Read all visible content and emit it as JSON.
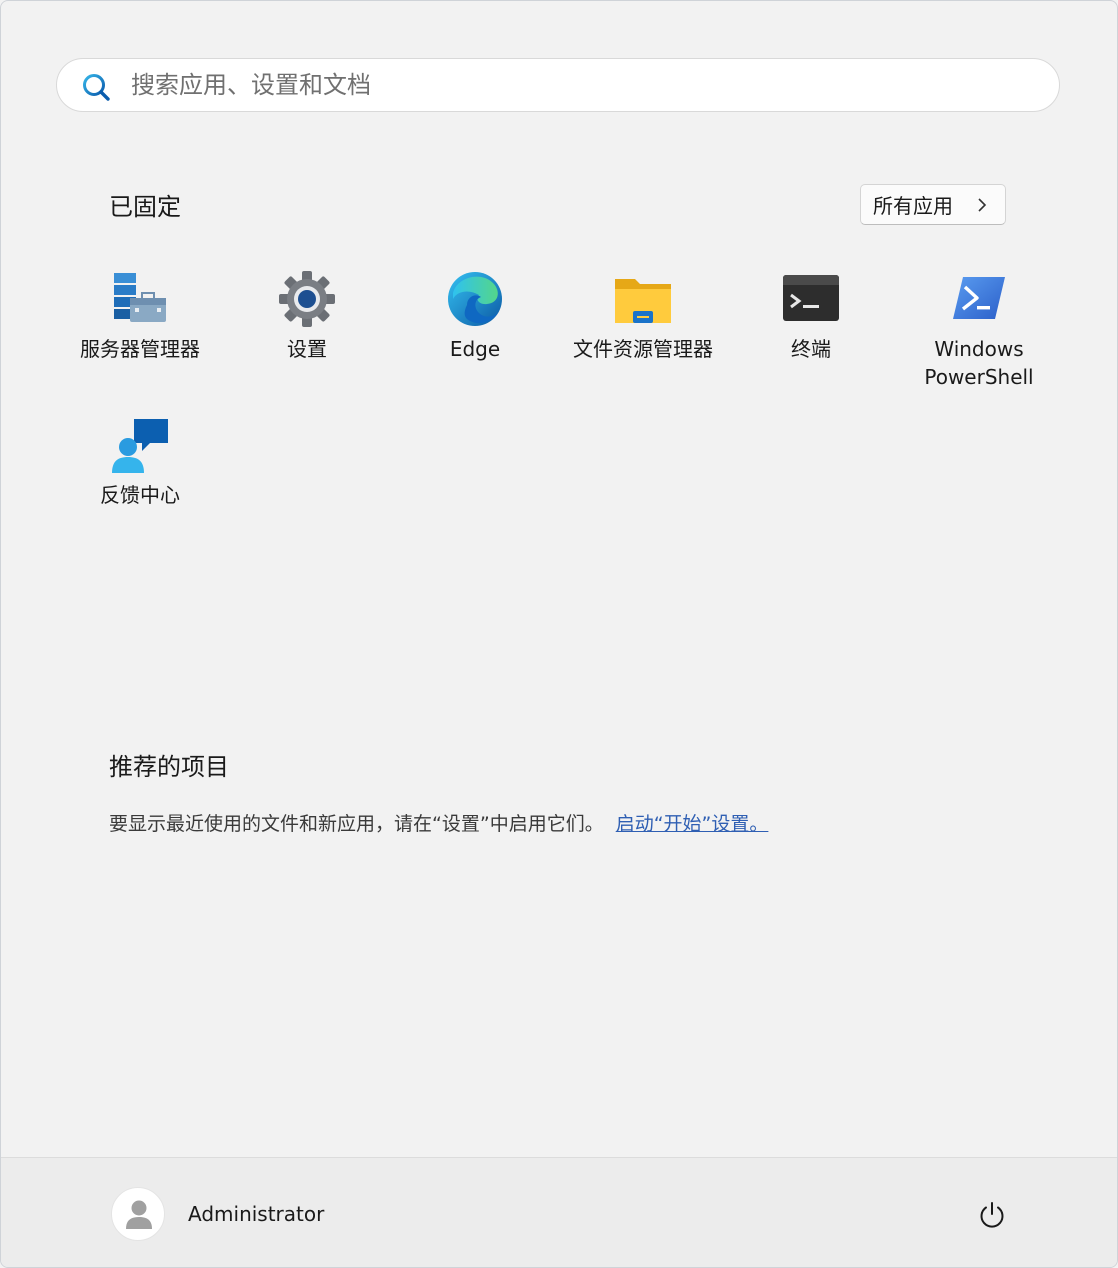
{
  "search": {
    "placeholder": "搜索应用、设置和文档"
  },
  "pinned": {
    "title": "已固定",
    "all_apps_label": "所有应用",
    "apps": [
      {
        "label": "服务器管理器",
        "icon": "server-manager-icon"
      },
      {
        "label": "设置",
        "icon": "settings-gear-icon"
      },
      {
        "label": "Edge",
        "icon": "edge-icon"
      },
      {
        "label": "文件资源管理器",
        "icon": "file-explorer-icon"
      },
      {
        "label": "终端",
        "icon": "terminal-icon"
      },
      {
        "label": "Windows\nPowerShell",
        "icon": "powershell-icon"
      },
      {
        "label": "反馈中心",
        "icon": "feedback-hub-icon"
      }
    ]
  },
  "recommended": {
    "title": "推荐的项目",
    "text": "要显示最近使用的文件和新应用，请在“设置”中启用它们。",
    "link": "启动“开始”设置。"
  },
  "footer": {
    "user_name": "Administrator",
    "avatar_icon": "user-avatar-icon",
    "power_icon": "power-icon"
  },
  "colors": {
    "background": "#f2f2f2",
    "link": "#2f5fb3",
    "accent": "#0067c0"
  }
}
